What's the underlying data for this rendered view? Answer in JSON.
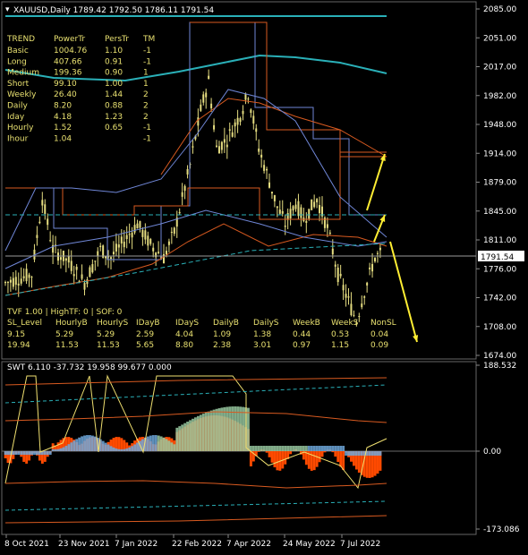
{
  "header": {
    "symbol_line": "XAUUSD,Daily  1789.42 1792.50 1786.11 1791.54"
  },
  "trend_table": {
    "columns": [
      "TREND",
      "PowerTr",
      "PersTr",
      "TM"
    ],
    "rows": [
      [
        "Basic",
        "1004.76",
        "1.10",
        "-1"
      ],
      [
        "Long",
        "407.66",
        "0.91",
        "-1"
      ],
      [
        "Medium",
        "199.36",
        "0.90",
        "1"
      ],
      [
        "Short",
        "99.10",
        "1.00",
        "1"
      ],
      [
        "Weekly",
        "26.40",
        "1.44",
        "2"
      ],
      [
        "Daily",
        "8.20",
        "0.88",
        "2"
      ],
      [
        "Iday",
        "4.18",
        "1.23",
        "2"
      ],
      [
        "Hourly",
        "1.52",
        "0.65",
        "-1"
      ],
      [
        "Ihour",
        "1.04",
        "",
        "-1"
      ]
    ]
  },
  "sl_table": {
    "line1": "TVF 1.00 | HighTF: 0 | SOF: 0",
    "columns": [
      "SL_Level",
      "HourlyB",
      "HourlyS",
      "IDayB",
      "IDayS",
      "DailyB",
      "DailyS",
      "WeekB",
      "WeekS",
      "NonSL"
    ],
    "rows": [
      [
        "9.15",
        "5.29",
        "5.29",
        "2.59",
        "4.04",
        "1.09",
        "1.38",
        "0.44",
        "0.53",
        "0.04"
      ],
      [
        "19.94",
        "11.53",
        "11.53",
        "5.65",
        "8.80",
        "2.38",
        "3.01",
        "0.97",
        "1.15",
        "0.09"
      ]
    ]
  },
  "price_axis": [
    "2085.00",
    "2051.00",
    "2017.00",
    "1982.00",
    "1948.00",
    "1914.00",
    "1879.00",
    "1845.00",
    "1811.00",
    "1776.00",
    "1742.00",
    "1708.00",
    "1674.00"
  ],
  "current_price": "1791.54",
  "indicator": {
    "label": "SWT 6.110 -37.732 19.958 99.677 0.000",
    "axis": [
      "188.532",
      "0.00",
      "-173.086"
    ]
  },
  "time_axis": [
    "8 Oct 2021",
    "23 Nov 2021",
    "7 Jan 2022",
    "22 Feb 2022",
    "7 Apr 2022",
    "24 May 2022",
    "7 Jul 2022"
  ],
  "colors": {
    "candles": "#e4dc80",
    "cyan_ma": "#2ab0b8",
    "orange_line": "#d85a20",
    "blue_band": "#6f86d6",
    "arrow": "#ffee33",
    "hist_orange": "#ff4a00",
    "hist_blue": "#6fa8dc",
    "hist_green": "#98c8a0"
  },
  "chart_data": {
    "type": "line",
    "title": "XAUUSD,Daily",
    "x": [
      "8 Oct 2021",
      "23 Nov 2021",
      "7 Jan 2022",
      "22 Feb 2022",
      "7 Apr 2022",
      "24 May 2022",
      "7 Jul 2022"
    ],
    "series": [
      {
        "values": [
          1760,
          1805,
          1790,
          1900,
          1930,
          1840,
          1735
        ]
      }
    ],
    "ylim": [
      1674,
      2085
    ]
  }
}
